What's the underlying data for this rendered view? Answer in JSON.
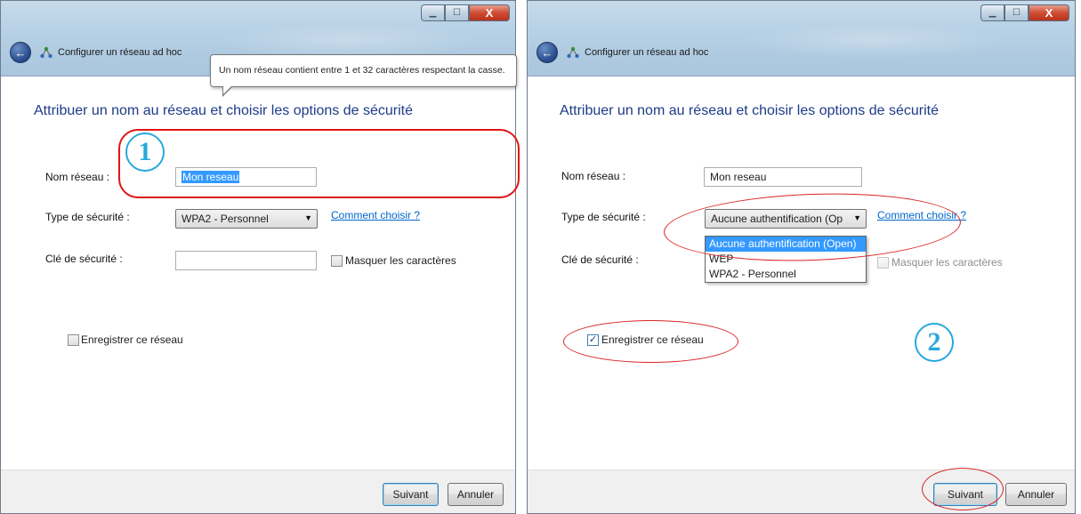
{
  "left_window": {
    "title": "Configurer un réseau ad hoc",
    "heading": "Attribuer un nom au réseau et choisir les options de sécurité",
    "network_name_label": "Nom réseau :",
    "network_name_value": "Mon reseau",
    "security_type_label": "Type de sécurité :",
    "security_type_value": "WPA2 - Personnel",
    "how_to_choose_link": "Comment choisir ?",
    "security_key_label": "Clé de sécurité :",
    "security_key_value": "",
    "hide_chars_label": "Masquer les caractères",
    "save_network_label": "Enregistrer ce réseau",
    "save_network_checked": false,
    "tooltip": "Un nom réseau contient entre 1 et 32 caractères respectant la casse.",
    "annotation_number": "1",
    "next_button": "Suivant",
    "cancel_button": "Annuler"
  },
  "right_window": {
    "title": "Configurer un réseau ad hoc",
    "heading": "Attribuer un nom au réseau et choisir les options de sécurité",
    "network_name_label": "Nom réseau :",
    "network_name_value": "Mon reseau",
    "security_type_label": "Type de sécurité :",
    "security_type_value": "Aucune authentification (Op",
    "security_type_options": [
      "Aucune authentification (Open)",
      "WEP",
      "WPA2 - Personnel"
    ],
    "security_type_selected_index": 0,
    "how_to_choose_link": "Comment choisir ?",
    "security_key_label": "Clé de sécurité :",
    "hide_chars_label": "Masquer les caractères",
    "save_network_label": "Enregistrer ce réseau",
    "save_network_checked": true,
    "annotation_number": "2",
    "next_button": "Suivant",
    "cancel_button": "Annuler"
  },
  "caption_buttons": {
    "minimize": "▁",
    "maximize": "☐",
    "close": "X"
  },
  "icons": {
    "back": "back-arrow-icon",
    "network": "adhoc-network-icon",
    "dropdown": "chevron-down-icon"
  },
  "colors": {
    "heading": "#1e3b87",
    "link": "#0066cc",
    "annotation_red": "#d92424",
    "annotation_blue": "#27a8dc",
    "selection": "#3399ff"
  }
}
